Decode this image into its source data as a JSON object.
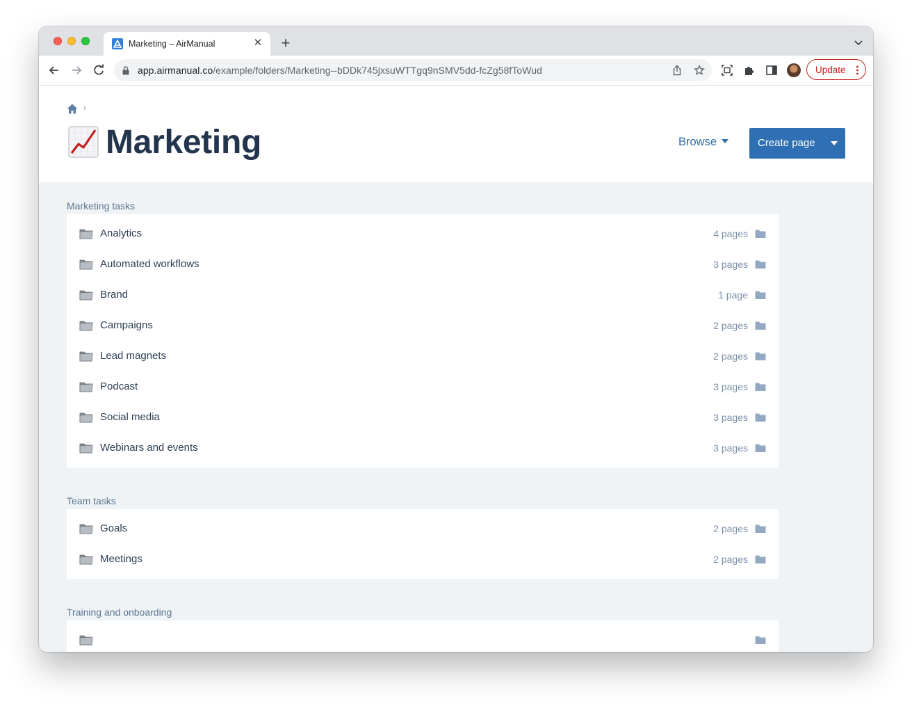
{
  "browser": {
    "tab_title": "Marketing – AirManual",
    "url_host": "app.airmanual.co",
    "url_path": "/example/folders/Marketing--bDDk745jxsuWTTgq9nSMV5dd-fcZg58fToWud",
    "update_label": "Update"
  },
  "header": {
    "title_emoji": "chart-increasing-emoji",
    "title": "Marketing",
    "browse_label": "Browse",
    "create_label": "Create page"
  },
  "sections": [
    {
      "title": "Marketing tasks",
      "items": [
        {
          "label": "Analytics",
          "count": "4 pages"
        },
        {
          "label": "Automated workflows",
          "count": "3 pages"
        },
        {
          "label": "Brand",
          "count": "1 page"
        },
        {
          "label": "Campaigns",
          "count": "2 pages"
        },
        {
          "label": "Lead magnets",
          "count": "2 pages"
        },
        {
          "label": "Podcast",
          "count": "3 pages"
        },
        {
          "label": "Social media",
          "count": "3 pages"
        },
        {
          "label": "Webinars and events",
          "count": "3 pages"
        }
      ]
    },
    {
      "title": "Team tasks",
      "items": [
        {
          "label": "Goals",
          "count": "2 pages"
        },
        {
          "label": "Meetings",
          "count": "2 pages"
        }
      ]
    },
    {
      "title": "Training and onboarding",
      "items": [
        {
          "label": "",
          "count": ""
        }
      ]
    }
  ],
  "colors": {
    "accent": "#2f6fb3",
    "title": "#23344d",
    "section_title": "#5b7592",
    "background": "#f0f3f6"
  }
}
